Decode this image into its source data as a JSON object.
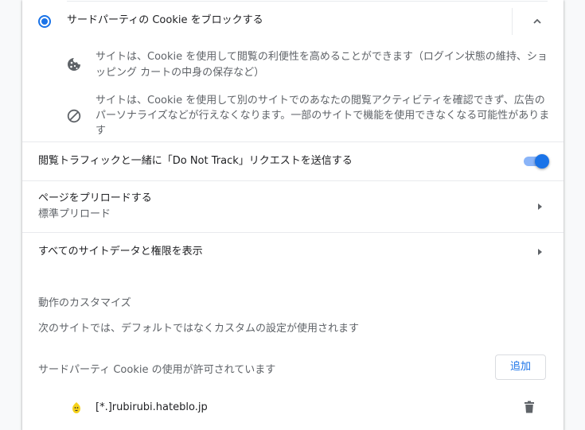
{
  "block_third_party": {
    "label": "サードパーティの Cookie をブロックする",
    "selected": true,
    "bullet1": {
      "icon": "cookie-icon",
      "line1": "サイトは、Cookie を使用して閲覧の利便性を高めることができます（ログイン状態の維持、ショ",
      "line2": "ッピング カートの中身の保存など）"
    },
    "bullet2": {
      "icon": "block-icon",
      "line1": "サイトは、Cookie を使用して別のサイトでのあなたの閲覧アクティビティを確認できず、広告の",
      "line2": "パーソナライズなどが行えなくなります。一部のサイトで機能を使用できなくなる可能性がありま",
      "line3": "す"
    }
  },
  "do_not_track": {
    "label": "閲覧トラフィックと一緒に「Do Not Track」リクエストを送信する",
    "enabled": true
  },
  "preload": {
    "label": "ページをプリロードする",
    "sublabel": "標準プリロード"
  },
  "all_site_data": {
    "label": "すべてのサイトデータと権限を表示"
  },
  "custom": {
    "heading": "動作のカスタマイズ",
    "description": "次のサイトでは、デフォルトではなくカスタムの設定が使用されます",
    "allowed_label": "サードパーティ Cookie の使用が許可されています",
    "add_button": "追加",
    "sites": [
      {
        "name": "[*.]rubirubi.hateblo.jp"
      }
    ]
  },
  "colors": {
    "accent": "#1a73e8",
    "toggle_track": "#8ab4f8",
    "secondary_text": "#5f6368",
    "divider": "#e8eaed"
  }
}
